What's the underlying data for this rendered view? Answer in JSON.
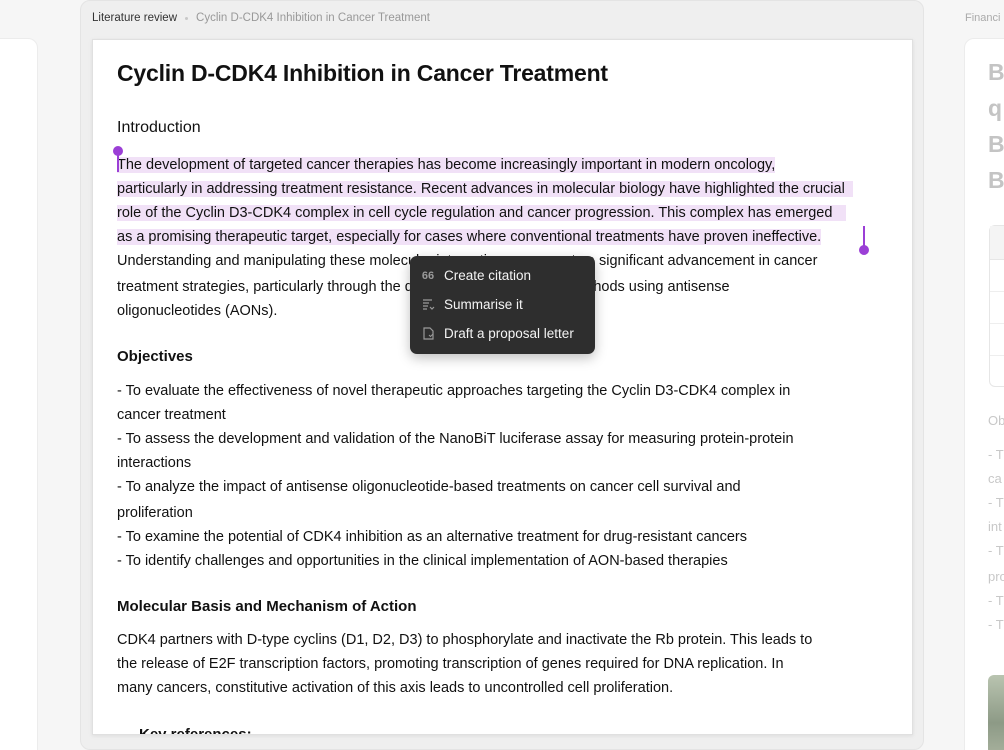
{
  "breadcrumb": {
    "root": "Literature review",
    "current": "Cyclin D-CDK4 Inhibition in Cancer Treatment"
  },
  "right_breadcrumb": "Financi",
  "document": {
    "title": "Cyclin D-CDK4 Inhibition in Cancer Treatment",
    "intro_heading": "Introduction",
    "intro_lines": [
      "The development of targeted cancer therapies has become increasingly important in modern oncology,",
      "particularly in addressing treatment resistance. Recent advances in molecular biology have highlighted the crucial",
      "role of the Cyclin D3-CDK4 complex in cell cycle regulation and cancer progression. This complex has emerged",
      "as a promising therapeutic target, especially for cases where conventional treatments have proven ineffective.",
      "Understanding and manipulating these molecular interactions represents a significant advancement in cancer",
      "treatment strategies, particularly through the development of inhibition methods using antisense",
      "oligonucleotides (AONs)."
    ],
    "objectives_heading": "Objectives",
    "objectives_lines": [
      "- To evaluate the effectiveness of novel therapeutic approaches targeting the Cyclin D3-CDK4 complex in",
      "cancer treatment",
      "- To assess the development and validation of the NanoBiT luciferase assay for measuring protein-protein",
      "interactions",
      "- To analyze the impact of antisense oligonucleotide-based treatments on cancer cell survival and",
      "proliferation",
      "- To examine the potential of CDK4 inhibition as an alternative treatment for drug-resistant cancers",
      "- To identify challenges and opportunities in the clinical implementation of AON-based therapies"
    ],
    "mechanism_heading": "Molecular Basis and Mechanism of Action",
    "mechanism_lines": [
      "CDK4 partners with D-type cyclins (D1, D2, D3) to phosphorylate and inactivate the Rb protein. This leads to",
      "the release of E2F transcription factors, promoting transcription of genes required for DNA replication. In",
      "many cancers, constitutive activation of this axis leads to uncontrolled cell proliferation."
    ],
    "key_references_heading": "Key references:"
  },
  "context_menu": {
    "items": [
      {
        "label": "Create citation",
        "icon": "quote-icon"
      },
      {
        "label": "Summarise it",
        "icon": "summarise-icon"
      },
      {
        "label": "Draft a proposal letter",
        "icon": "document-icon"
      }
    ]
  },
  "right_panel": {
    "big_letters": [
      "B",
      "q",
      "B",
      "B"
    ],
    "section_label": "Ob",
    "fragments": [
      "- T",
      "ca",
      "- T",
      "int",
      "- T",
      "pro",
      "- T",
      "- T"
    ]
  },
  "colors": {
    "highlight": "#f1e1f7",
    "selection_handle": "#9b3fd6",
    "menu_bg": "#2e2e2e"
  }
}
